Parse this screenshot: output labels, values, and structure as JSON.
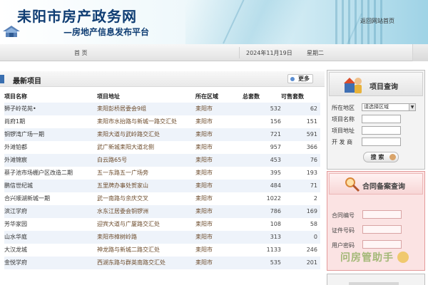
{
  "header": {
    "site_title": "耒阳市房产政务网",
    "subtitle": "—房地产信息发布平台",
    "back_link": "返回网站首页"
  },
  "nav": {
    "home": "首 页",
    "date": "2024年11月19日",
    "weekday": "星期二"
  },
  "listing": {
    "title": "最新项目",
    "more": "更多",
    "columns": [
      "项目名称",
      "项目地址",
      "所在区域",
      "总套数",
      "可售套数"
    ],
    "rows": [
      [
        "狮子岭花苑•",
        "耒阳彭桥居委会9组",
        "耒阳市",
        "532",
        "62"
      ],
      [
        "尚府1期",
        "耒阳市水抬路与新城一路交汇处",
        "耒阳市",
        "156",
        "151"
      ],
      [
        "铜锣湾广场一期",
        "耒阳大道与武岭路交汇处",
        "耒阳市",
        "721",
        "591"
      ],
      [
        "外滩铂都",
        "武广新城耒阳大道北侧",
        "耒阳市",
        "957",
        "366"
      ],
      [
        "外滩锦宸",
        "白云路65号",
        "耒阳市",
        "453",
        "76"
      ],
      [
        "蔡子池市场棚户区改造二期",
        "五一东路五一广场旁",
        "耒阳市",
        "395",
        "193"
      ],
      [
        "鹏信世纪城",
        "五里牌办事处贺家山",
        "耒阳市",
        "484",
        "71"
      ],
      [
        "合兴顺湖新城一期",
        "武一南路与余庆交叉",
        "耒阳市",
        "1022",
        "2"
      ],
      [
        "滨江学府",
        "水东江居委会铜锣洲",
        "耒阳市",
        "786",
        "169"
      ],
      [
        "芳华家园",
        "迎宾大道与广厦路交汇处",
        "耒阳市",
        "108",
        "58"
      ],
      [
        "山水华庭",
        "耒阳市樟树岭路",
        "耒阳市",
        "313",
        "0"
      ],
      [
        "大汉龙城",
        "神龙路与新城二路交汇处",
        "耒阳市",
        "1133",
        "246"
      ],
      [
        "金悦学府",
        "西湖东路与群英南路交汇处",
        "耒阳市",
        "535",
        "201"
      ]
    ]
  },
  "project_query": {
    "title": "项目查询",
    "area_label": "所在地区",
    "area_selected": "请选择区域",
    "name_label": "项目名称",
    "address_label": "项目地址",
    "developer_label": "开 发 商",
    "search_button": "搜 索"
  },
  "contract_query": {
    "title": "合同备案查询",
    "contract_label": "合同编号",
    "id_label": "证件号码",
    "password_label": "用户密码",
    "watermark": "问房管助手"
  },
  "colors": {
    "brand_blue": "#0f3d73",
    "row_stripe": "#eef3fa",
    "contract_bg": "#fbe3e3"
  }
}
